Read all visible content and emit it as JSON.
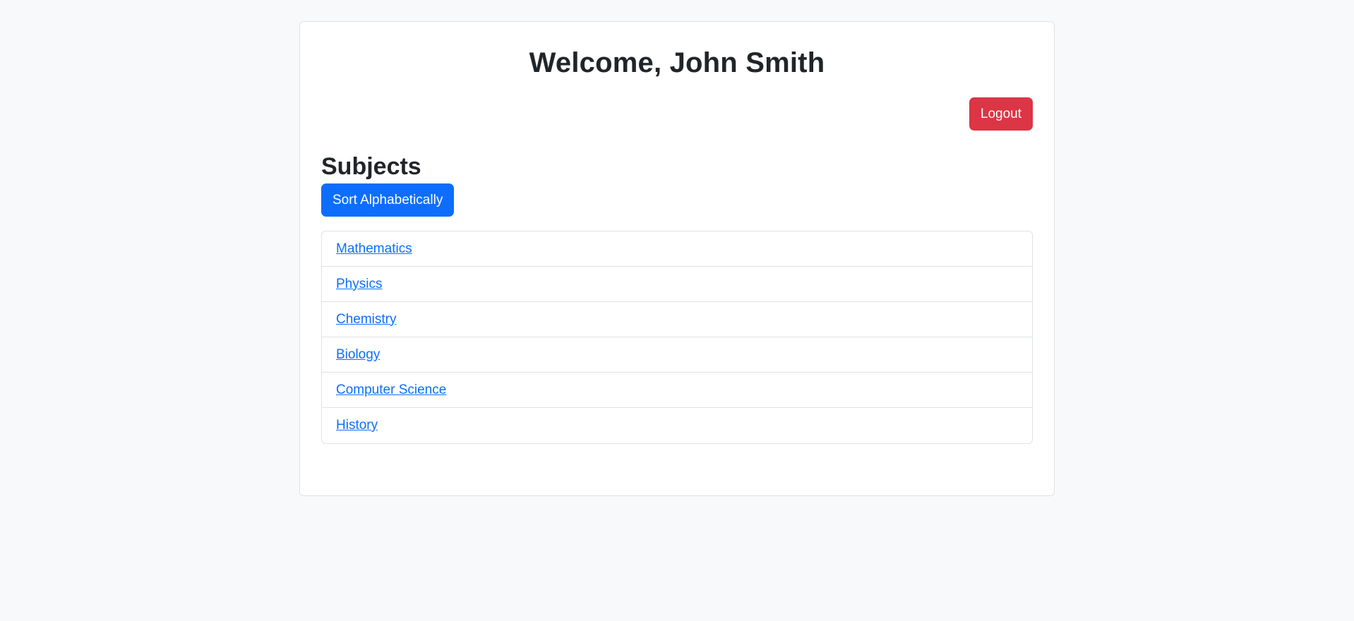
{
  "header": {
    "title": "Welcome, John Smith",
    "logout_label": "Logout"
  },
  "subjects": {
    "heading": "Subjects",
    "sort_label": "Sort Alphabetically",
    "items": [
      {
        "label": "Mathematics"
      },
      {
        "label": "Physics"
      },
      {
        "label": "Chemistry"
      },
      {
        "label": "Biology"
      },
      {
        "label": "Computer Science"
      },
      {
        "label": "History"
      }
    ]
  },
  "colors": {
    "page_background": "#f8f9fa",
    "danger": "#dc3545",
    "primary": "#0d6efd",
    "link": "#0d6efd",
    "border": "#dee2e6"
  }
}
